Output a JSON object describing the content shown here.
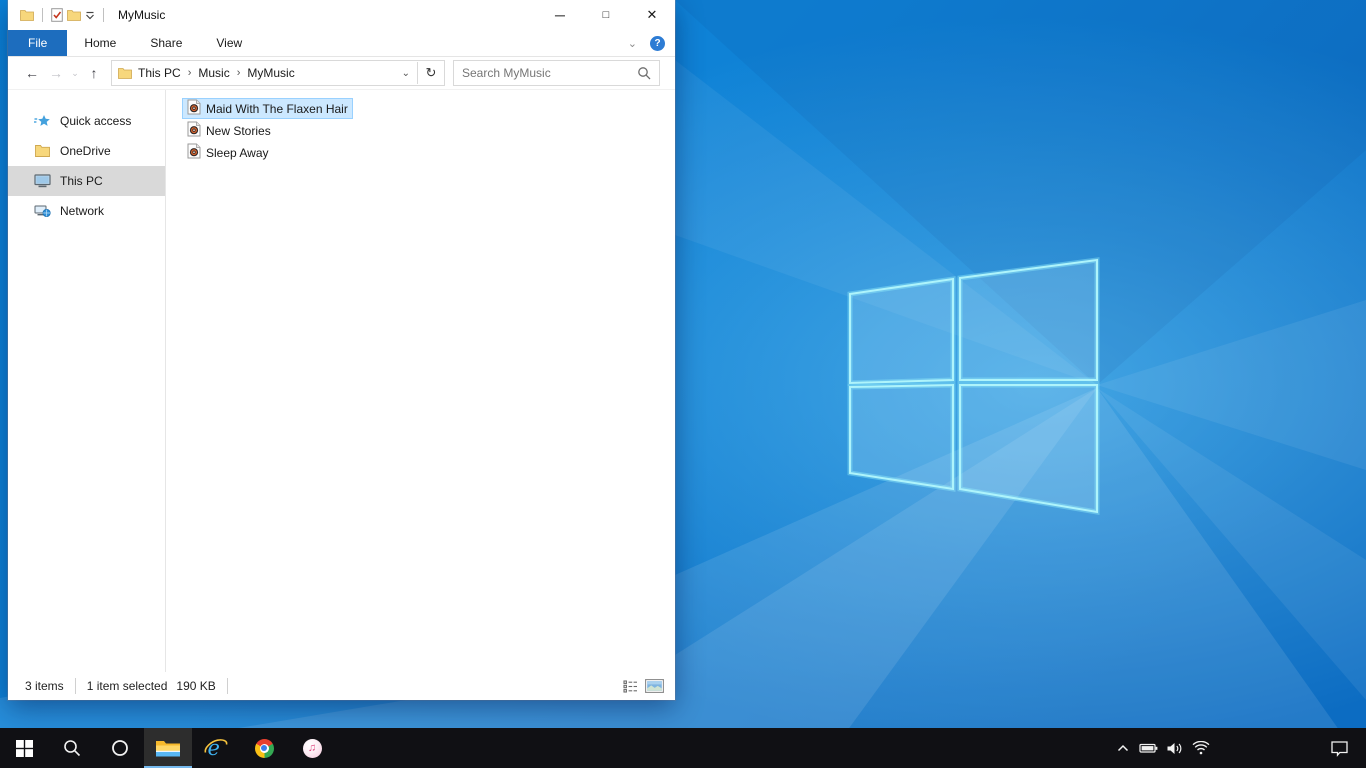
{
  "glyphs": {
    "minimize": "─",
    "maximize": "□",
    "close": "✕",
    "help": "?",
    "ribbon_collapse": "⌄",
    "back": "←",
    "forward": "→",
    "nav_history": "⌄",
    "up": "↑",
    "address_dropdown": "⌄",
    "refresh": "↻",
    "breadcrumb_sep": "›",
    "ie_letter": "e",
    "itunes_note": "♫"
  },
  "explorer": {
    "title": "MyMusic",
    "tabs": [
      {
        "label": "File",
        "active": true
      },
      {
        "label": "Home",
        "active": false
      },
      {
        "label": "Share",
        "active": false
      },
      {
        "label": "View",
        "active": false
      }
    ],
    "breadcrumb": {
      "segments": [
        "This PC",
        "Music",
        "MyMusic"
      ]
    },
    "search": {
      "placeholder": "Search MyMusic"
    },
    "sidebar": {
      "items": [
        {
          "label": "Quick access",
          "selected": false
        },
        {
          "label": "OneDrive",
          "selected": false
        },
        {
          "label": "This PC",
          "selected": true
        },
        {
          "label": "Network",
          "selected": false
        }
      ]
    },
    "files": {
      "items": [
        {
          "name": "Maid With The Flaxen Hair",
          "selected": true
        },
        {
          "name": "New Stories",
          "selected": false
        },
        {
          "name": "Sleep Away",
          "selected": false
        }
      ]
    },
    "status": {
      "count": "3 items",
      "selection": "1 item selected",
      "size": "190 KB"
    }
  },
  "taskbar": {
    "buttons": [
      {
        "name": "start"
      },
      {
        "name": "search"
      },
      {
        "name": "cortana"
      },
      {
        "name": "file-explorer",
        "active": true
      },
      {
        "name": "internet-explorer"
      },
      {
        "name": "chrome"
      },
      {
        "name": "itunes"
      }
    ],
    "tray": [
      "hidden-icons",
      "battery",
      "volume",
      "wifi",
      "action-center"
    ]
  },
  "colors": {
    "file_tab_blue": "#1d6dbe",
    "selection_fill": "#cce8ff",
    "selection_border": "#99d1ff",
    "sidebar_selected": "#d9d9d9",
    "taskbar_bg": "#101014",
    "taskbar_active_underline": "#76b9ed",
    "wallpaper_blue": "#0d7ad2",
    "help_badge_blue": "#2d7cd4"
  }
}
